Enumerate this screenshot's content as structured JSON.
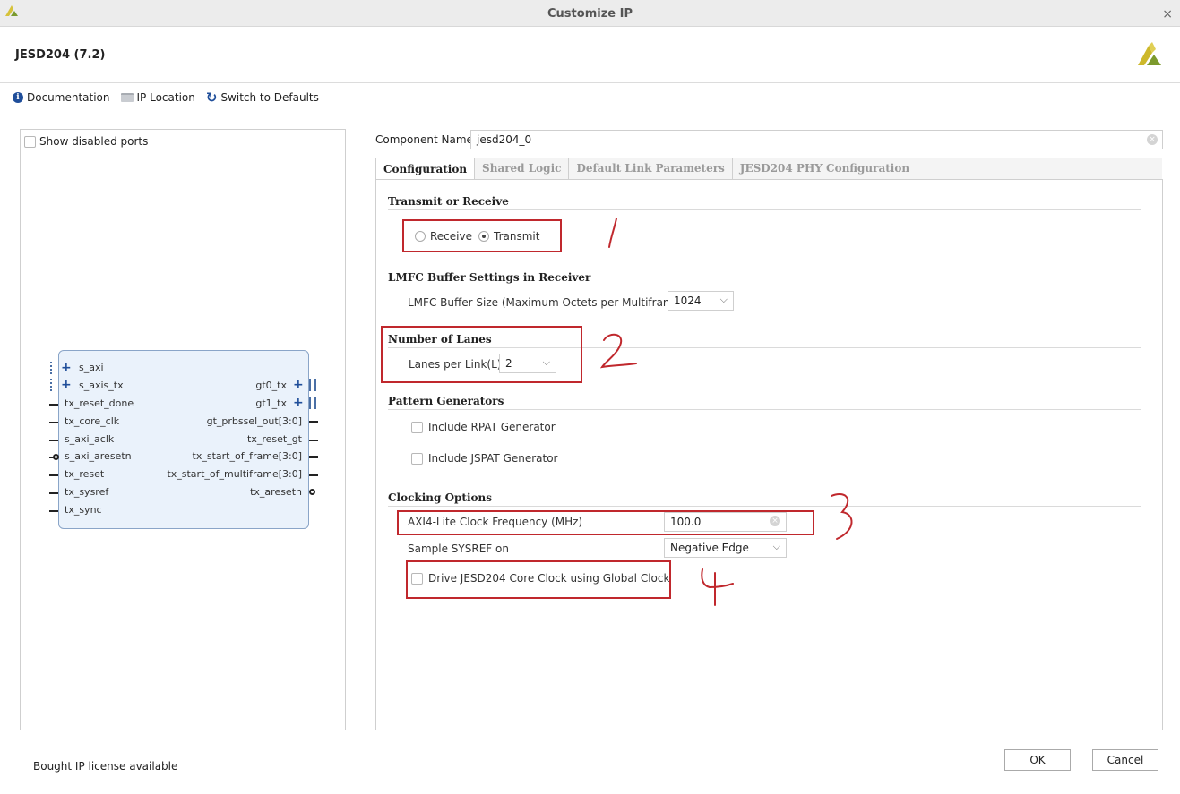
{
  "window": {
    "title": "Customize IP",
    "close_glyph": "×"
  },
  "header": {
    "ip_name": "JESD204 (7.2)"
  },
  "toolbar": {
    "documentation": "Documentation",
    "ip_location": "IP Location",
    "switch_defaults": "Switch to Defaults"
  },
  "left": {
    "show_disabled": "Show disabled ports",
    "symbol": {
      "left_ports": [
        "s_axi",
        "s_axis_tx",
        "tx_reset_done",
        "tx_core_clk",
        "s_axi_aclk",
        "s_axi_aresetn",
        "tx_reset",
        "tx_sysref",
        "tx_sync"
      ],
      "right_ports": [
        "gt0_tx",
        "gt1_tx",
        "gt_prbssel_out[3:0]",
        "tx_reset_gt",
        "tx_start_of_frame[3:0]",
        "tx_start_of_multiframe[3:0]",
        "tx_aresetn"
      ]
    }
  },
  "component": {
    "label": "Component Name",
    "value": "jesd204_0"
  },
  "tabs": [
    "Configuration",
    "Shared Logic",
    "Default Link Parameters",
    "JESD204 PHY Configuration"
  ],
  "config": {
    "transmit_section": "Transmit or Receive",
    "receive_label": "Receive",
    "transmit_label": "Transmit",
    "lmfc_section": "LMFC Buffer Settings in Receiver",
    "lmfc_label": "LMFC Buffer Size (Maximum Octets per Multiframe)",
    "lmfc_value": "1024",
    "lanes_section": "Number of Lanes",
    "lanes_label": "Lanes per Link(L)",
    "lanes_value": "2",
    "pattern_section": "Pattern Generators",
    "rpat_label": "Include RPAT Generator",
    "jspat_label": "Include JSPAT Generator",
    "clocking_section": "Clocking Options",
    "axi_clock_label": "AXI4-Lite Clock Frequency (MHz)",
    "axi_clock_value": "100.0",
    "sysref_label": "Sample SYSREF on",
    "sysref_value": "Negative Edge",
    "drive_clock_label": "Drive JESD204 Core Clock using Global Clock"
  },
  "annotations": {
    "color": "#c0282d"
  },
  "footer": {
    "license": "Bought IP license available",
    "ok": "OK",
    "cancel": "Cancel"
  }
}
